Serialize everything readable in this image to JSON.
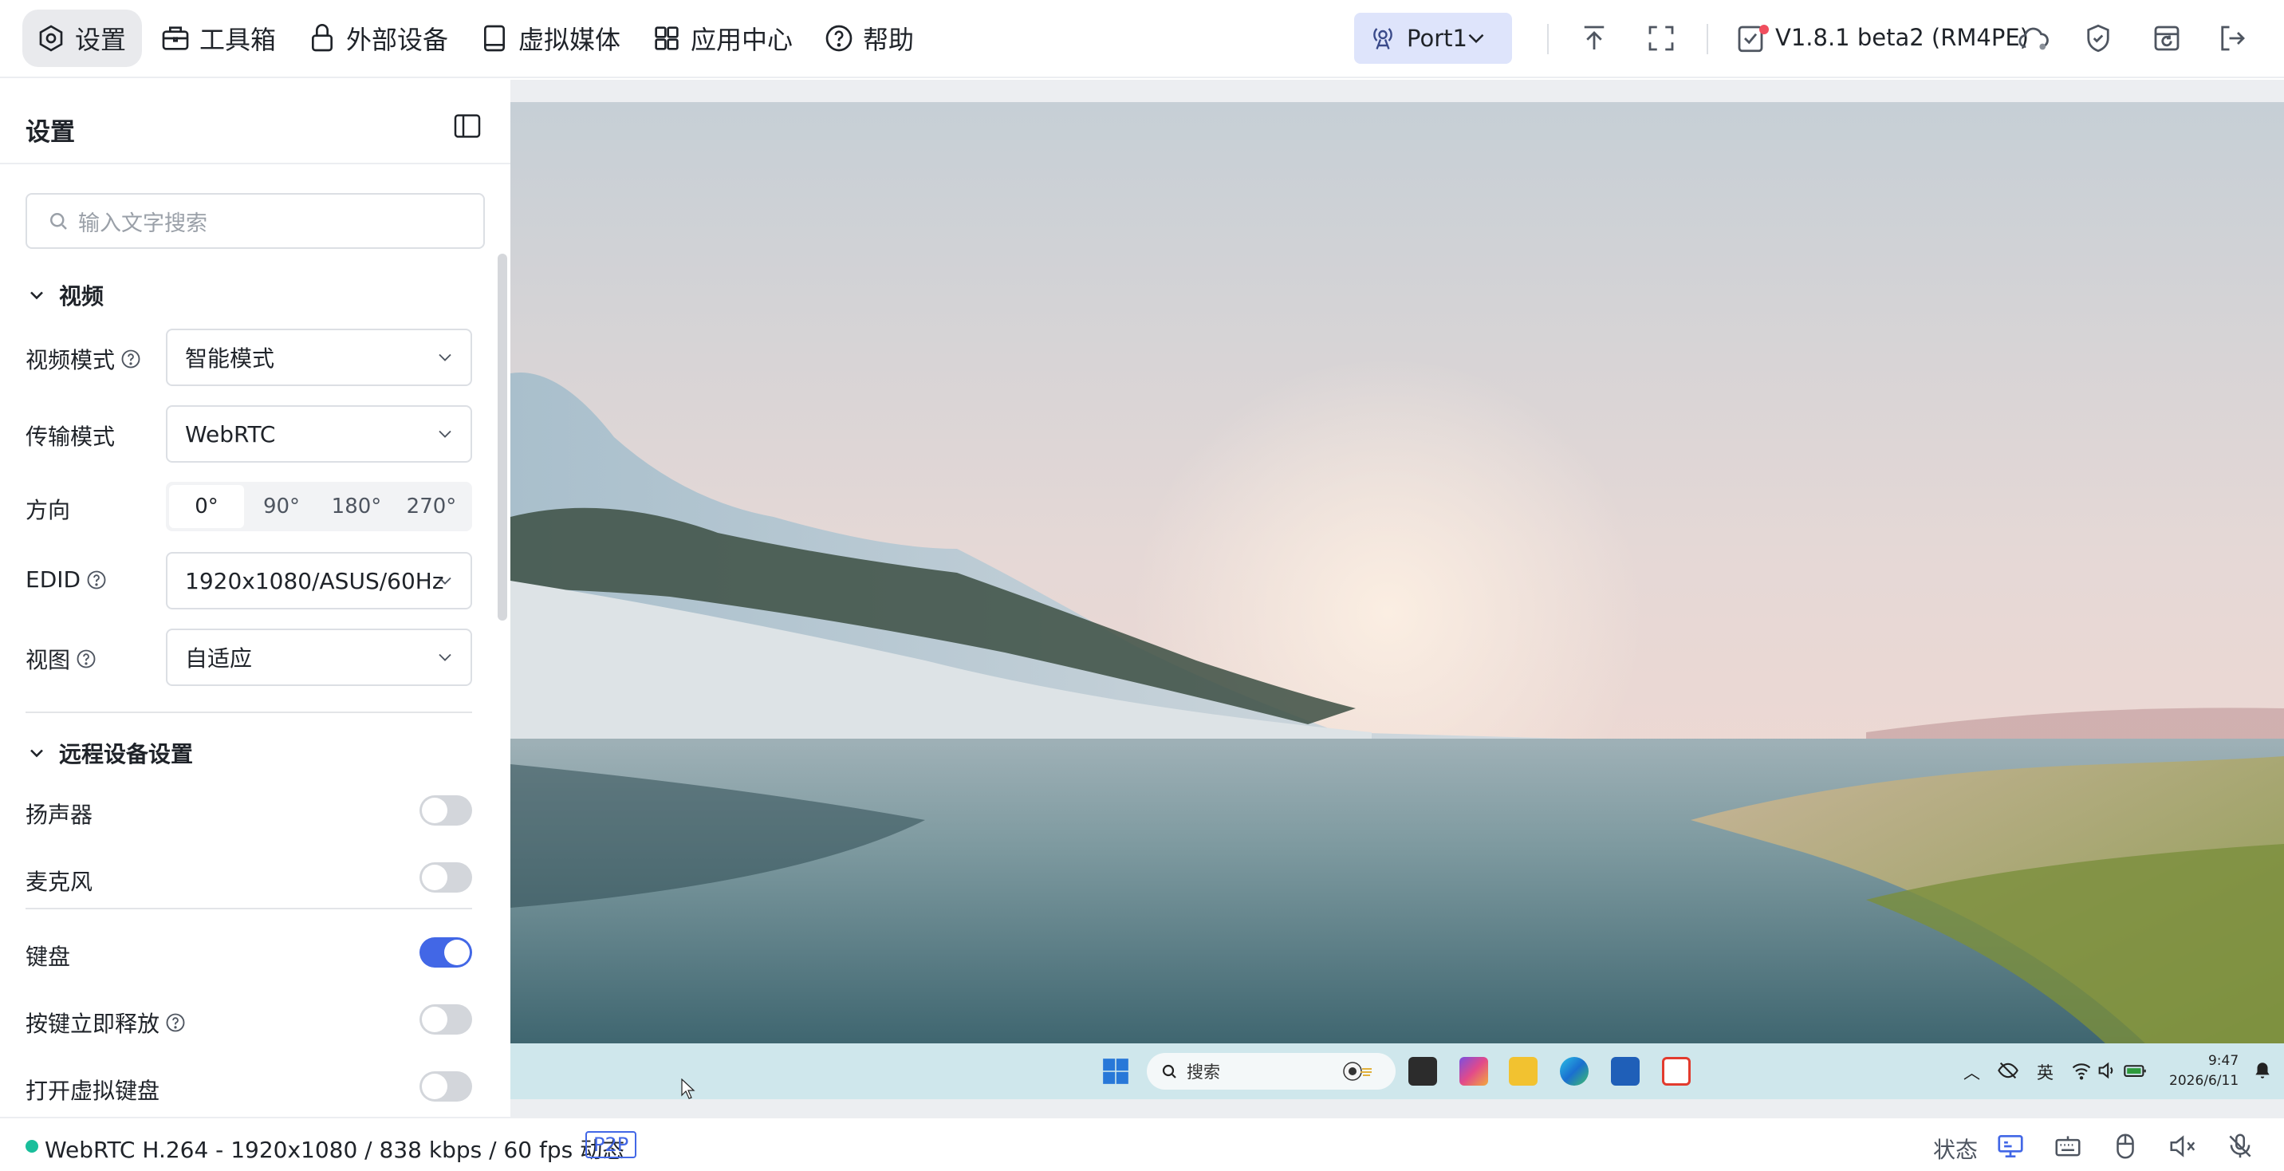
{
  "nav": {
    "items": [
      {
        "label": "设置",
        "icon": "settings-icon"
      },
      {
        "label": "工具箱",
        "icon": "toolbox-icon"
      },
      {
        "label": "外部设备",
        "icon": "lock-device-icon"
      },
      {
        "label": "虚拟媒体",
        "icon": "virtual-media-icon"
      },
      {
        "label": "应用中心",
        "icon": "app-grid-icon"
      },
      {
        "label": "帮助",
        "icon": "help-icon"
      }
    ]
  },
  "port": {
    "label": "Port1"
  },
  "version": {
    "label": "V1.8.1 beta2 (RM4PE)"
  },
  "sidebar": {
    "title": "设置",
    "search_placeholder": "输入文字搜索",
    "video": {
      "heading": "视频",
      "video_mode_label": "视频模式",
      "video_mode_value": "智能模式",
      "transport_label": "传输模式",
      "transport_value": "WebRTC",
      "orientation_label": "方向",
      "orientation_options": [
        "0°",
        "90°",
        "180°",
        "270°"
      ],
      "orientation_selected": "0°",
      "edid_label": "EDID",
      "edid_value": "1920x1080/ASUS/60Hz",
      "view_label": "视图",
      "view_value": "自适应"
    },
    "remote": {
      "heading": "远程设备设置",
      "speaker_label": "扬声器",
      "speaker_on": false,
      "mic_label": "麦克风",
      "mic_on": false,
      "keyboard_label": "键盘",
      "keyboard_on": true,
      "instant_release_label": "按键立即释放",
      "instant_release_on": false,
      "virtual_keyboard_label": "打开虚拟键盘",
      "virtual_keyboard_on": false
    }
  },
  "remote_screen": {
    "taskbar_search": "搜索",
    "tray_ime": "英",
    "clock_time": "9:47",
    "clock_date": "2026/6/11"
  },
  "statusbar": {
    "stream_info": "WebRTC H.264 - 1920x1080 / 838 kbps / 60 fps 动态",
    "badge": "P2P",
    "status_label": "状态"
  },
  "colors": {
    "accent": "#4267e6",
    "online": "#19be9b",
    "port_bg": "#dee4fb"
  }
}
